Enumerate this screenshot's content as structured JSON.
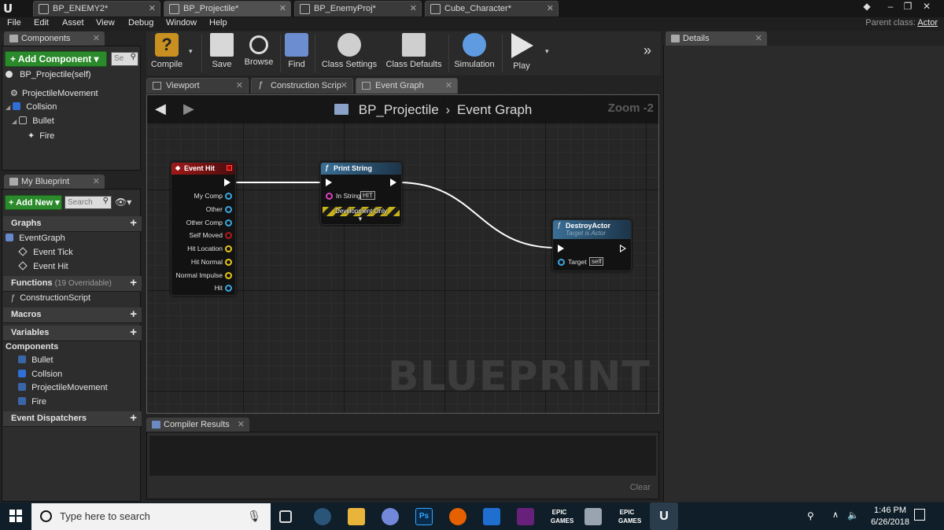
{
  "titlebar": {
    "tabs": [
      {
        "label": "BP_ENEMY2*"
      },
      {
        "label": "BP_Projectile*"
      },
      {
        "label": "BP_EnemyProj*"
      },
      {
        "label": "Cube_Character*"
      }
    ]
  },
  "menu": {
    "items": [
      "File",
      "Edit",
      "Asset",
      "View",
      "Debug",
      "Window",
      "Help"
    ],
    "parent_class_label": "Parent class:",
    "parent_class_value": "Actor"
  },
  "components_panel": {
    "tab_label": "Components",
    "add_button": "+ Add Component ▾",
    "search_placeholder": "Se",
    "self_item": "BP_Projectile(self)",
    "tree": [
      {
        "label": "ProjectileMovement"
      },
      {
        "label": "Collsion"
      },
      {
        "label": "Bullet"
      },
      {
        "label": "Fire"
      }
    ]
  },
  "my_blueprint": {
    "tab_label": "My Blueprint",
    "add_new": "+ Add New ▾",
    "search_placeholder": "Search",
    "graphs_header": "Graphs",
    "graphs": [
      "EventGraph",
      "Event Tick",
      "Event Hit"
    ],
    "functions_header": "Functions",
    "functions_sub": "(19 Overridable)",
    "functions": [
      "ConstructionScript"
    ],
    "macros_header": "Macros",
    "variables_header": "Variables",
    "components_header": "Components",
    "components": [
      "Bullet",
      "Collsion",
      "ProjectileMovement",
      "Fire"
    ],
    "dispatchers_header": "Event Dispatchers"
  },
  "toolbar": {
    "buttons": [
      "Compile",
      "Save",
      "Browse",
      "Find",
      "Class Settings",
      "Class Defaults",
      "Simulation",
      "Play"
    ]
  },
  "editor_tabs": [
    "Viewport",
    "Construction Scrip",
    "Event Graph"
  ],
  "graph": {
    "breadcrumb_root": "BP_Projectile",
    "breadcrumb_leaf": "Event Graph",
    "zoom": "Zoom -2",
    "watermark": "BLUEPRINT",
    "event_hit": {
      "title": "Event Hit",
      "pins": [
        "My Comp",
        "Other",
        "Other Comp",
        "Self Moved",
        "Hit Location",
        "Hit Normal",
        "Normal Impulse",
        "Hit"
      ]
    },
    "print_string": {
      "title": "Print String",
      "in_string_label": "In String",
      "in_string_value": "HIT",
      "dev_only": "Development Only"
    },
    "destroy_actor": {
      "title": "DestroyActor",
      "subtitle": "Target is Actor",
      "target_label": "Target",
      "target_value": "self"
    }
  },
  "compiler": {
    "tab_label": "Compiler Results",
    "clear": "Clear"
  },
  "details": {
    "tab_label": "Details"
  },
  "taskbar": {
    "search_placeholder": "Type here to search",
    "time": "1:46 PM",
    "date": "6/26/2018"
  }
}
